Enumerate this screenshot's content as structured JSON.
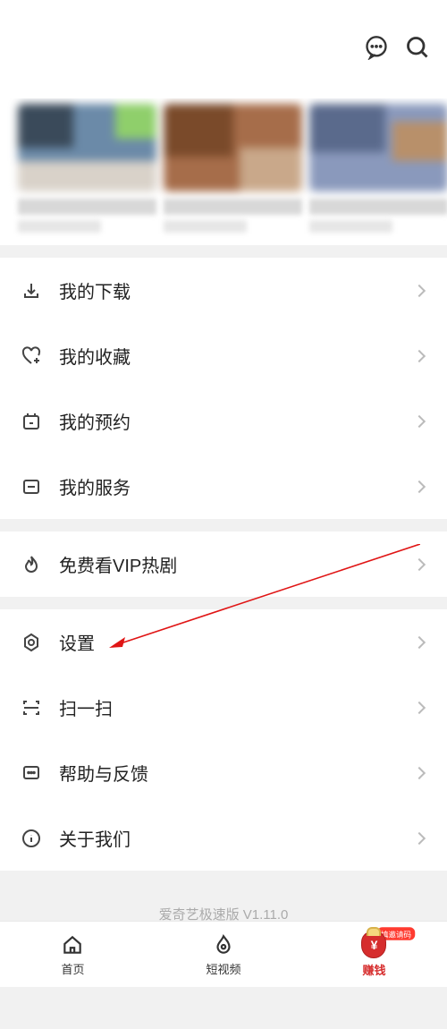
{
  "menu": {
    "downloads": "我的下载",
    "favorites": "我的收藏",
    "reservations": "我的预约",
    "services": "我的服务",
    "free_vip": "免费看VIP热剧",
    "settings": "设置",
    "scan": "扫一扫",
    "help": "帮助与反馈",
    "about": "关于我们"
  },
  "footer": "爱奇艺极速版 V1.11.0",
  "tabs": {
    "home": "首页",
    "short_video": "短视频",
    "money_badge": "填邀请码",
    "money_label": "赚钱"
  }
}
